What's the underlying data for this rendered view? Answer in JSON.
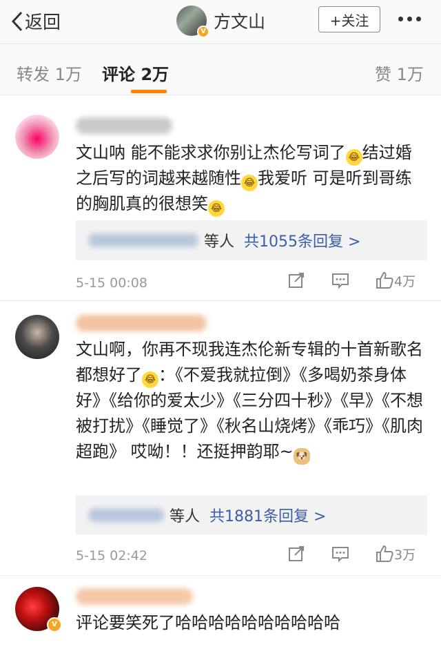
{
  "nav": {
    "back_label": "返回",
    "title": "方文山",
    "follow_label": "+关注"
  },
  "tabs": {
    "repost": "转发 1万",
    "comments": "评论 2万",
    "likes": "赞 1万"
  },
  "comments": [
    {
      "text_parts": [
        "文山呐 能不能求求你别让杰伦写词了",
        "结过婚之后写的词越来越随性",
        "我爱听 可是听到哥练的胸肌真的很想笑"
      ],
      "reply_who": "等人",
      "reply_count": "共1055条回复 >",
      "time": "5-15 00:08",
      "likes": "4万"
    },
    {
      "text_parts": [
        "文山啊，你再不现我连杰伦新专辑的十首新歌名都想好了",
        "：《不爱我就拉倒》《多喝奶茶身体好》《给你的爱太少》《三分四十秒》《早》《不想被打扰》《睡觉了》《秋名山烧烤》《乖巧》《肌肉超跑》 哎呦！！还挺押韵耶~"
      ],
      "reply_who": "等人",
      "reply_count": "共1881条回复 >",
      "time": "5-15 02:42",
      "likes": "3万"
    },
    {
      "text_parts": [
        "评论要笑死了哈哈哈哈哈哈哈哈哈哈"
      ]
    }
  ],
  "icons": {
    "back": "chevron-left-icon",
    "more": "more-dots-icon",
    "repost": "share-icon",
    "comment": "comment-icon",
    "like": "thumbs-up-icon",
    "verified": "verified-badge-icon",
    "laugh_emoji": "laugh-cry-emoji",
    "doge_emoji": "doge-emoji"
  },
  "colors": {
    "accent": "#ff8200",
    "link": "#3b5ea8",
    "verified": "#f5a623"
  }
}
